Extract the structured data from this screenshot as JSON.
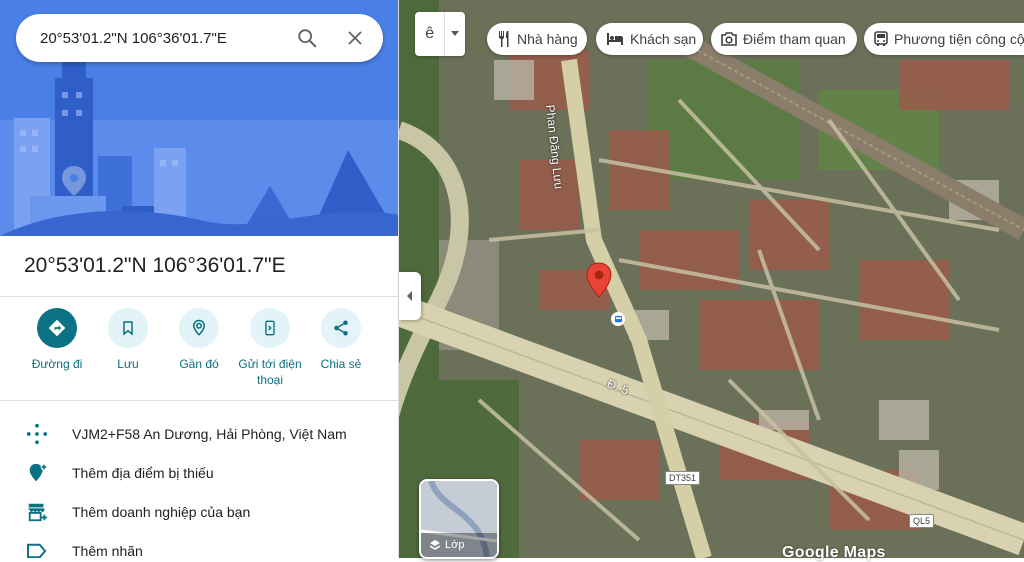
{
  "search": {
    "value": "20°53'01.2\"N 106°36'01.7\"E"
  },
  "place": {
    "title": "20°53'01.2\"N 106°36'01.7\"E"
  },
  "actions": [
    {
      "label": "Đường đi",
      "icon": "directions-icon"
    },
    {
      "label": "Lưu",
      "icon": "bookmark-icon"
    },
    {
      "label": "Gần đó",
      "icon": "nearby-icon"
    },
    {
      "label": "Gửi tới điện thoại",
      "icon": "send-to-phone-icon"
    },
    {
      "label": "Chia sẻ",
      "icon": "share-icon"
    }
  ],
  "details": [
    {
      "text": "VJM2+F58 An Dương, Hải Phòng, Việt Nam",
      "icon": "plus-code-icon"
    },
    {
      "text": "Thêm địa điểm bị thiếu",
      "icon": "add-location-icon"
    },
    {
      "text": "Thêm doanh nghiệp của bạn",
      "icon": "add-business-icon"
    },
    {
      "text": "Thêm nhãn",
      "icon": "label-icon"
    }
  ],
  "map": {
    "lang_button": "ê",
    "chips": [
      {
        "label": "Nhà hàng",
        "icon": "restaurant-icon"
      },
      {
        "label": "Khách sạn",
        "icon": "hotel-icon"
      },
      {
        "label": "Điểm tham quan",
        "icon": "camera-icon"
      },
      {
        "label": "Phương tiện công cộ",
        "icon": "bus-icon"
      }
    ],
    "street_labels": {
      "phan_dang_luu": "Phan Đăng Lưu",
      "d5": "Đ. 5",
      "dt351": "DT351",
      "ql5": "QL5"
    },
    "layers_label": "Lớp",
    "watermark": "Google Maps"
  },
  "colors": {
    "accent": "#0b7285",
    "hero_blue": "#4f82e6",
    "pin_red": "#ea4335"
  }
}
